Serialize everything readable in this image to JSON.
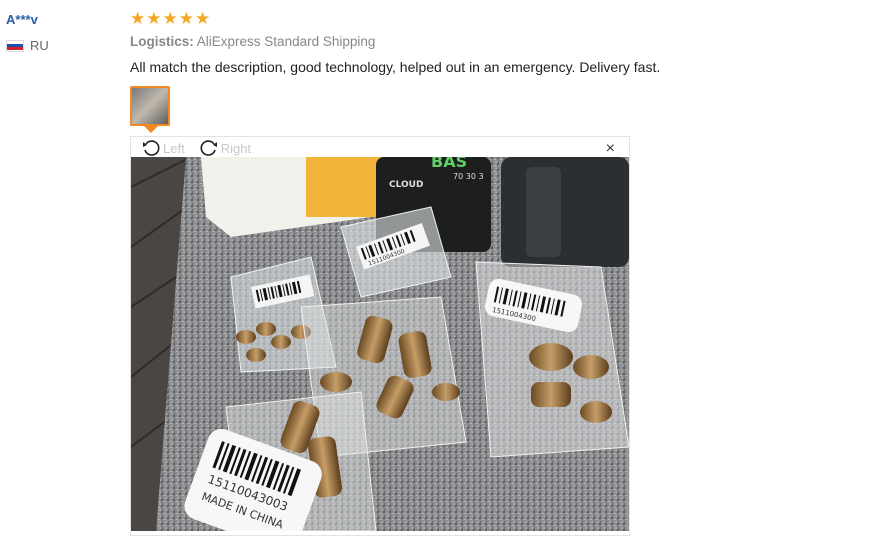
{
  "reviewer": {
    "name": "A***v",
    "country": "RU"
  },
  "rating": {
    "stars": 5,
    "max": 5,
    "color": "#f6a623"
  },
  "logistics": {
    "label": "Logistics:",
    "value": "AliExpress Standard Shipping"
  },
  "review": {
    "text": "All match the description, good technology, helped out in an emergency. Delivery fast."
  },
  "viewer": {
    "rotate_left_label": "Left",
    "rotate_right_label": "Right",
    "close_symbol": "×"
  },
  "photo": {
    "bag_labels": [
      "1511004300",
      "15110043003",
      "1511004300",
      "1511004300"
    ],
    "made_in": "MADE IN CHINA",
    "bottle_brand": "CLOUD",
    "bottle_label": "BAS",
    "bottle_numbers": "70 30 3"
  },
  "colors": {
    "accent": "#f08a24",
    "link": "#2b5fa8"
  },
  "icons": [
    "flag-ru-icon",
    "star-icon",
    "rotate-left-icon",
    "rotate-right-icon",
    "close-icon"
  ]
}
